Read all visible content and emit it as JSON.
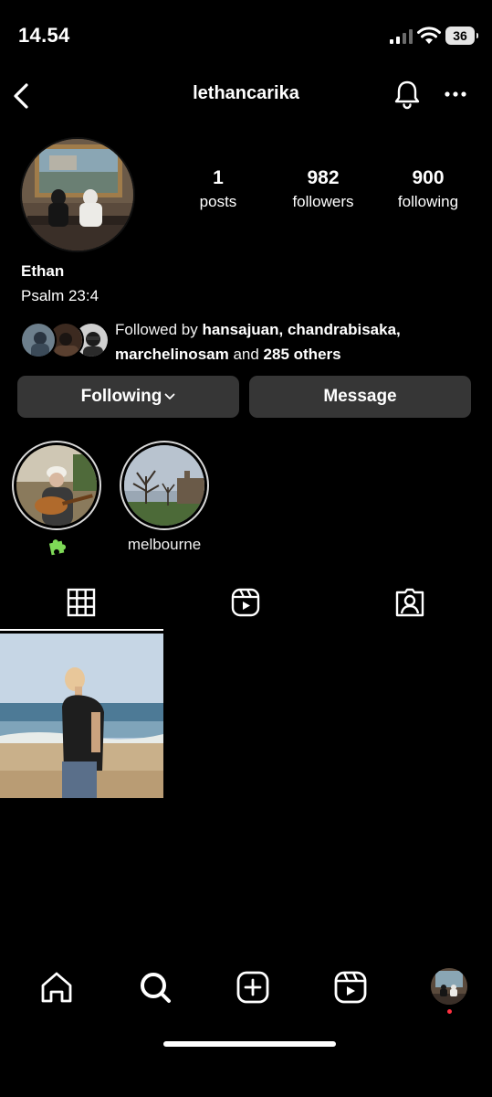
{
  "status_bar": {
    "time": "14.54",
    "battery": "36"
  },
  "header": {
    "username": "lethancarika"
  },
  "stats": [
    {
      "value": "1",
      "label": "posts"
    },
    {
      "value": "982",
      "label": "followers"
    },
    {
      "value": "900",
      "label": "following"
    }
  ],
  "profile": {
    "name": "Ethan",
    "bio": "Psalm 23:4"
  },
  "followed_by": {
    "prefix": "Followed by ",
    "users": "hansajuan, chandrabisaka, marchelinosam",
    "joiner": " and ",
    "others": "285 others"
  },
  "buttons": {
    "following": "Following",
    "message": "Message"
  },
  "highlights": [
    {
      "label": "",
      "icon": "puzzle-icon"
    },
    {
      "label": "melbourne"
    }
  ],
  "tabs": [
    "grid-icon",
    "reels-icon",
    "tagged-icon"
  ],
  "bottom_nav": [
    "home-icon",
    "search-icon",
    "create-icon",
    "reels-icon",
    "profile-avatar"
  ],
  "colors": {
    "background": "#000000",
    "button": "#363636",
    "notification": "#ff3040",
    "puzzle": "#7ed957"
  }
}
